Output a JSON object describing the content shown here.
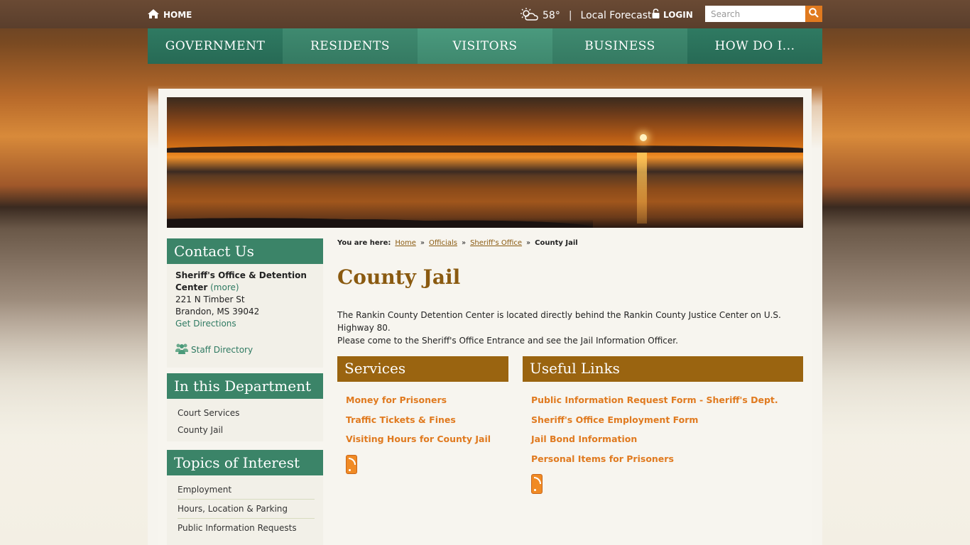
{
  "topbar": {
    "home_label": "HOME",
    "temperature": "58°",
    "forecast_label": "Local Forecast",
    "login_label": "LOGIN",
    "search_placeholder": "Search"
  },
  "nav": {
    "items": [
      {
        "label": "GOVERNMENT"
      },
      {
        "label": "RESIDENTS"
      },
      {
        "label": "VISITORS"
      },
      {
        "label": "BUSINESS"
      },
      {
        "label": "HOW DO I..."
      }
    ]
  },
  "sidebar": {
    "contact": {
      "heading": "Contact Us",
      "org_name": "Sheriff's Office & Detention Center",
      "more_label": "(more)",
      "street": "221 N Timber St",
      "city": "Brandon, MS 39042",
      "directions_label": "Get Directions",
      "staff_label": "Staff Directory"
    },
    "department": {
      "heading": "In this Department",
      "items": [
        "Court Services",
        "County Jail"
      ]
    },
    "topics": {
      "heading": "Topics of Interest",
      "items": [
        "Employment",
        "Hours, Location & Parking",
        "Public Information Requests"
      ]
    }
  },
  "breadcrumb": {
    "label": "You are here:",
    "items": [
      "Home",
      "Officials",
      "Sheriff's Office"
    ],
    "separator": "»",
    "current": "County Jail"
  },
  "main": {
    "title": "County Jail",
    "intro_line1": "The Rankin County Detention Center is located directly behind the Rankin County Justice Center on U.S. Highway 80.",
    "intro_line2": "Please come to the Sheriff's Office Entrance and see the Jail Information Officer.",
    "services": {
      "heading": "Services",
      "items": [
        "Money for Prisoners",
        "Traffic Tickets & Fines",
        "Visiting Hours for County Jail"
      ]
    },
    "useful_links": {
      "heading": "Useful Links",
      "items": [
        "Public Information Request Form - Sheriff's Dept.",
        "Sheriff's Office Employment Form",
        "Jail Bond Information",
        "Personal Items for Prisoners"
      ]
    }
  },
  "colors": {
    "nav_green": "#2f7a62",
    "side_head_green": "#3b8468",
    "box_head_brown": "#9a6410",
    "link_orange": "#e07a1f",
    "title_brown": "#8a5a10"
  },
  "icons": [
    "home-icon",
    "weather-partly-cloudy-icon",
    "lock-icon",
    "search-icon",
    "staff-group-icon",
    "rss-icon"
  ]
}
